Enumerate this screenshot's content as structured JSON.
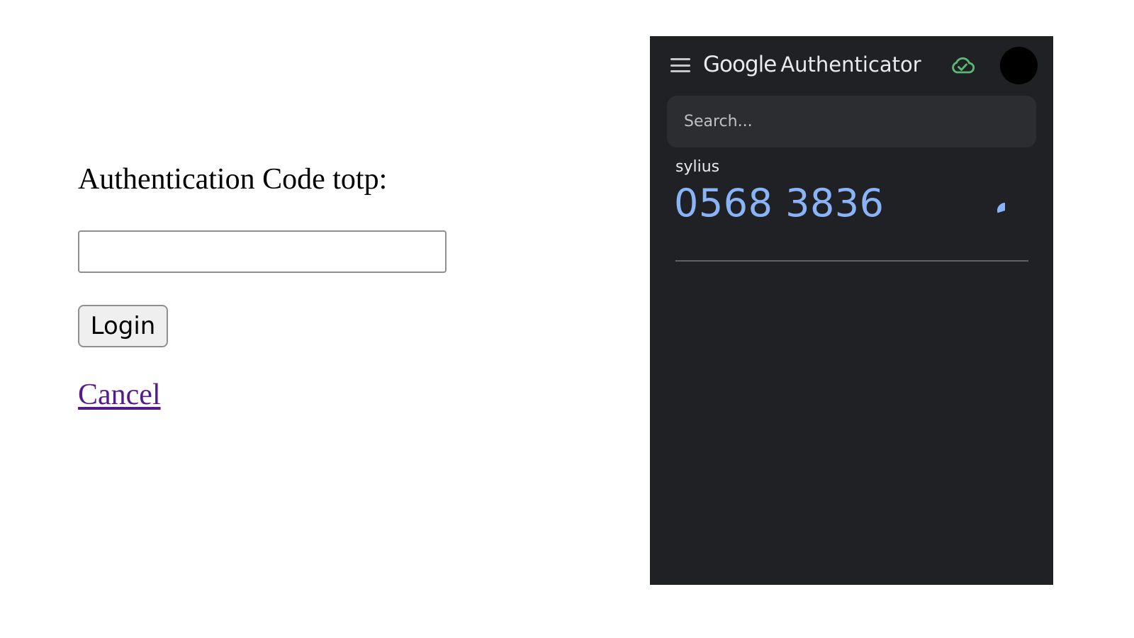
{
  "login_form": {
    "label": "Authentication Code totp:",
    "code_value": "",
    "login_button": "Login",
    "cancel_link": "Cancel"
  },
  "authenticator": {
    "brand": "Google",
    "product": "Authenticator",
    "icons": {
      "menu": "menu-icon",
      "sync": "cloud-done-icon",
      "avatar": "avatar",
      "timer": "countdown-timer-icon"
    },
    "colors": {
      "background": "#202124",
      "code": "#8ab4f8",
      "sync": "#5bb974"
    },
    "search": {
      "placeholder": "Search..."
    },
    "accounts": [
      {
        "name": "sylius",
        "code": "0568 3836",
        "time_remaining_fraction": 0.3
      }
    ]
  }
}
